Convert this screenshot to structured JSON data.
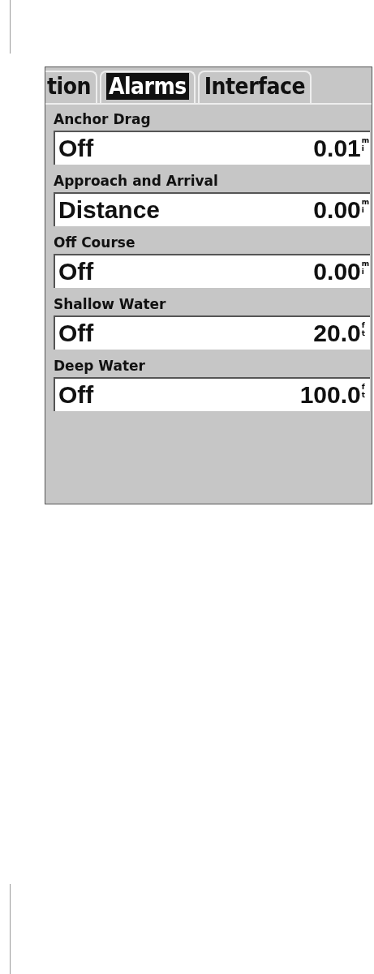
{
  "tabs": [
    {
      "label": "tion",
      "selected": false
    },
    {
      "label": "Alarms",
      "selected": true
    },
    {
      "label": "Interface",
      "selected": false
    }
  ],
  "alarms": [
    {
      "label": "Anchor Drag",
      "mode": "Off",
      "value": "0.01",
      "unit": "mi"
    },
    {
      "label": "Approach and Arrival",
      "mode": "Distance",
      "value": "0.00",
      "unit": "mi"
    },
    {
      "label": "Off Course",
      "mode": "Off",
      "value": "0.00",
      "unit": "mi"
    },
    {
      "label": "Shallow Water",
      "mode": "Off",
      "value": "20.0",
      "unit": "ft"
    },
    {
      "label": "Deep Water",
      "mode": "Off",
      "value": "100.0",
      "unit": "ft"
    }
  ]
}
